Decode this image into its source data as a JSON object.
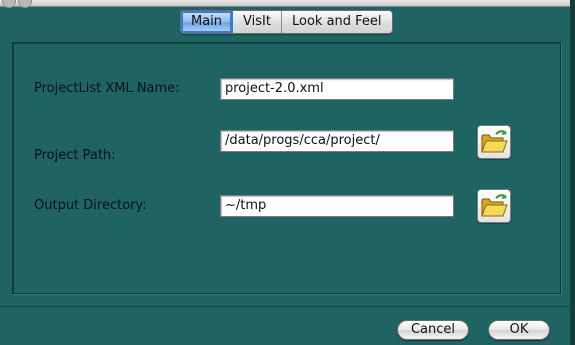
{
  "tabs": [
    {
      "label": "Main",
      "selected": true
    },
    {
      "label": "VisIt",
      "selected": false
    },
    {
      "label": "Look and Feel",
      "selected": false
    }
  ],
  "form": {
    "project_list": {
      "label": "ProjectList XML Name:",
      "value": "project-2.0.xml"
    },
    "project_path": {
      "label": "Project Path:",
      "value": "/data/progs/cca/project/",
      "browse_icon": "open-folder-icon"
    },
    "output_dir": {
      "label": "Output Directory:",
      "value": "~/tmp",
      "browse_icon": "open-folder-icon"
    }
  },
  "buttons": {
    "cancel": "Cancel",
    "ok": "OK"
  },
  "colors": {
    "background": "#1f6363",
    "selected_tab": "#8fbcec"
  }
}
